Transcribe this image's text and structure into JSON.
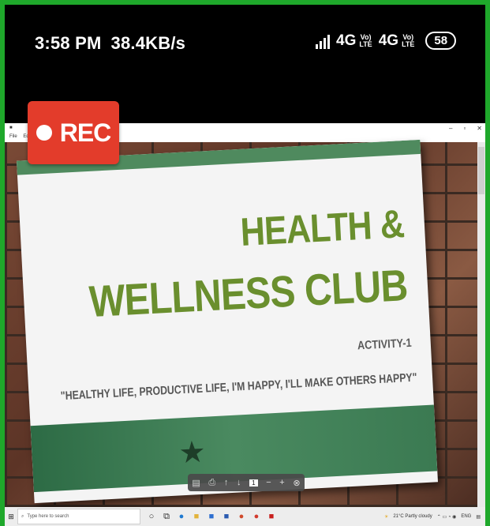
{
  "status_bar": {
    "time": "3:58 PM",
    "speed": "38.4KB/s",
    "network_1": "4G",
    "network_2": "4G",
    "volte_top": "Vo)",
    "volte_bottom": "LTE",
    "battery": "58"
  },
  "recording": {
    "label": "REC"
  },
  "window": {
    "menu_file": "File",
    "menu_edit": "Edit"
  },
  "slide": {
    "title_line1": "HEALTH &",
    "title_line2": "WELLNESS CLUB",
    "activity": "ACTIVITY-1",
    "quote": "\"HEALTHY LIFE, PRODUCTIVE LIFE, I'M HAPPY, I'LL MAKE OTHERS HAPPY\""
  },
  "pdf_toolbar": {
    "page": "1"
  },
  "taskbar": {
    "search_placeholder": "Type here to search",
    "weather": "21°C Partly cloudy",
    "lang": "ENG"
  },
  "colors": {
    "frame_green": "#1fa82b",
    "rec_red": "#e33c2b",
    "title_green": "#6a8f2e",
    "band_green": "#4a8a60"
  }
}
